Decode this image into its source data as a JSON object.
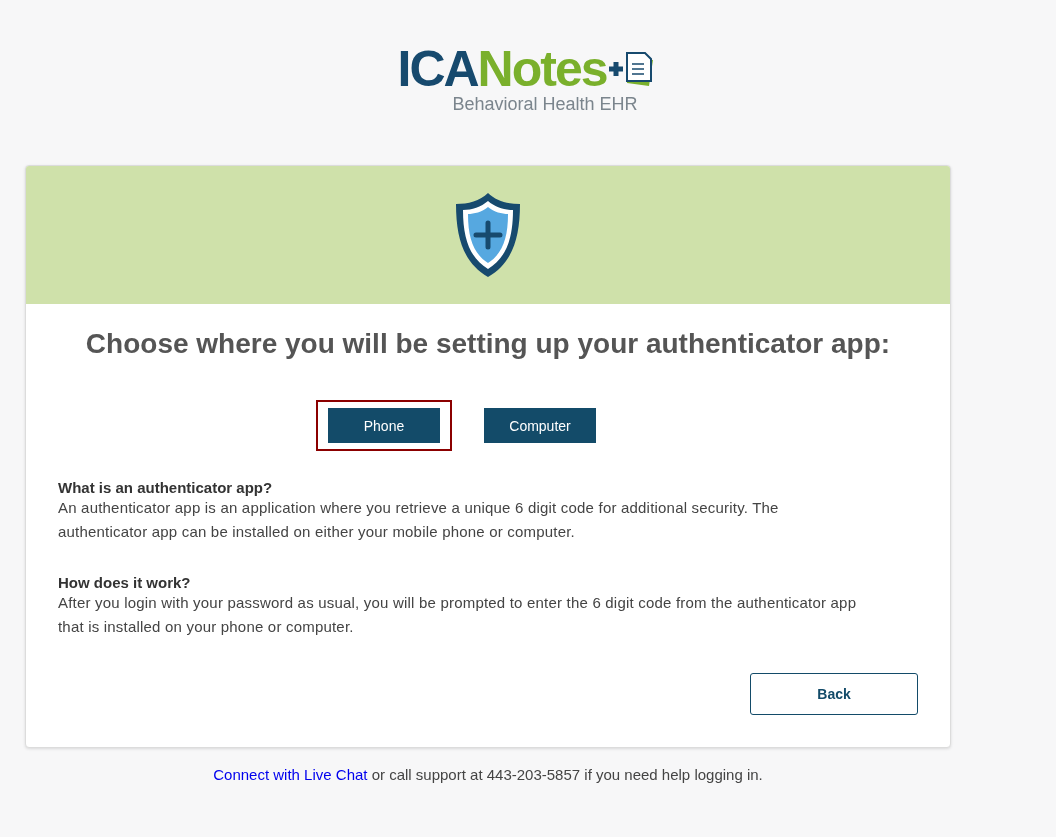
{
  "logo": {
    "brand_first": "ICA",
    "brand_second": "Notes",
    "tagline": "Behavioral Health EHR"
  },
  "card": {
    "title": "Choose where you will be setting up your authenticator app:",
    "options": [
      {
        "label": "Phone",
        "selected": true
      },
      {
        "label": "Computer",
        "selected": false
      }
    ],
    "sections": [
      {
        "heading": "What is an authenticator app?",
        "body": "An authenticator app is an application where you retrieve a unique 6 digit code for additional security. The authenticator app can be installed on either your mobile phone or computer."
      },
      {
        "heading": "How does it work?",
        "body": "After you login with your password as usual, you will be prompted to enter the 6 digit code from the authenticator app that is installed on your phone or computer."
      }
    ],
    "back_button": "Back"
  },
  "footer": {
    "link": "Connect with Live Chat",
    "text": "or call support at 443-203-5857 if you need help logging in."
  }
}
